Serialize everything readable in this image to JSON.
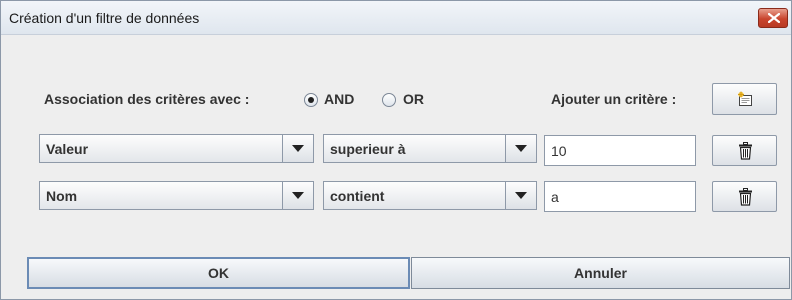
{
  "window": {
    "title": "Création d'un filtre de données"
  },
  "association": {
    "label": "Association des critères avec :",
    "options": [
      "AND",
      "OR"
    ],
    "selected": "AND"
  },
  "add_criterion": {
    "label": "Ajouter un critère :",
    "icon": "new-document-icon"
  },
  "criteria": [
    {
      "field": "Valeur",
      "operator": "superieur à",
      "value": "10",
      "delete_icon": "trash-icon"
    },
    {
      "field": "Nom",
      "operator": "contient",
      "value": "a",
      "delete_icon": "trash-icon"
    }
  ],
  "footer": {
    "ok_label": "OK",
    "cancel_label": "Annuler"
  },
  "colors": {
    "close_button": "#c9452e",
    "focus_border": "#6b8bb5"
  }
}
